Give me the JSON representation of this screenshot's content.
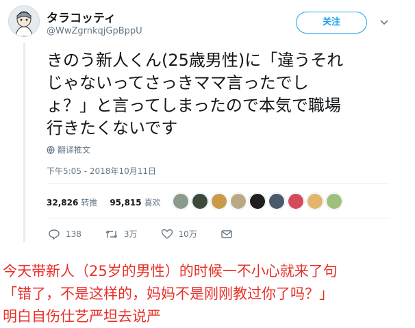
{
  "user": {
    "display_name": "タラコッティ",
    "handle": "@WwZgrnkqjGpBppU"
  },
  "follow_label": "关注",
  "tweet_lines": [
    "きのう新人くん(25歳男性)に「違うそれ",
    "じゃないってさっきママ言ったでし",
    "ょ？」と言ってしまったので本気で職場",
    "行きたくないです"
  ],
  "translate_label": "翻译推文",
  "timestamp": "下午5:05 - 2018年10月11日",
  "stats": {
    "retweets_count": "32,826",
    "retweets_label": "转推",
    "likes_count": "95,815",
    "likes_label": "喜欢"
  },
  "liker_avatar_colors": [
    "#8a9a8c",
    "#3d4a3b",
    "#c89a4a",
    "#b9a883",
    "#1f1f1f",
    "#4a5a6a",
    "#d24a5c",
    "#e2b46c",
    "#9fc07a"
  ],
  "actions": {
    "reply_count": "138",
    "retweet_count": "3万",
    "like_count": "10万"
  },
  "caption_lines": [
    "今天带新人（25岁的男性）的时候一不小心就来了句",
    "「错了，不是这样的，妈妈不是刚刚教过你了吗？」",
    "明白自伤仕艺严坦去说严"
  ],
  "colors": {
    "accent": "#1da1f2",
    "caption": "#e8312a",
    "muted": "#657786"
  }
}
